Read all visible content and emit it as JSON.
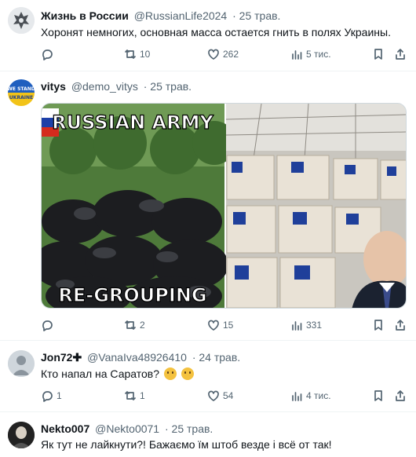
{
  "tweets": [
    {
      "name": "Жизнь в России",
      "handle": "@RussianLife2024",
      "date": "· 25 трав.",
      "text": "Хоронят немногих, основная масса остается гнить в полях Украины.",
      "replies": "",
      "retweets": "10",
      "likes": "262",
      "views": "5 тис."
    },
    {
      "name": "vitys",
      "handle": "@demo_vitys",
      "date": "· 25 трав.",
      "avatar_text": "WE STAND UKRAINE",
      "media_left_top": "RUSSIAN ARMY",
      "media_left_bottom": "RE-GROUPING",
      "coffin_label": "Единая Россия",
      "replies": "",
      "retweets": "2",
      "likes": "15",
      "views": "331"
    },
    {
      "name": "Jon72✚",
      "handle": "@VanaIva48926410",
      "date": "· 24 трав.",
      "text": "Кто напал на Саратов?",
      "replies": "1",
      "retweets": "1",
      "likes": "54",
      "views": "4 тис."
    },
    {
      "name": "Nekto007",
      "handle": "@Nekto0071",
      "date": "· 25 трав.",
      "text": "Як тут не лайкнути?! Бажаємо їм  штоб везде і всё от так!"
    }
  ],
  "colors": {
    "secondary_text": "#536471",
    "divider": "#eff3f4"
  }
}
